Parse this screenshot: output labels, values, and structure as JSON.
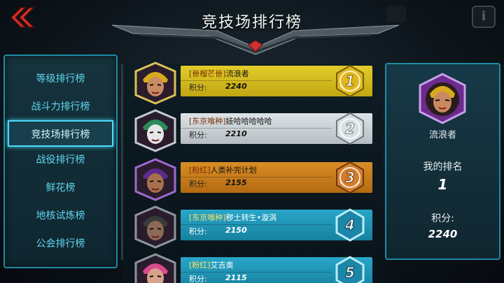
{
  "header": {
    "title": "竞技场排行榜"
  },
  "menu": {
    "items": [
      {
        "label": "等级排行榜"
      },
      {
        "label": "战斗力排行榜"
      },
      {
        "label": "竞技场排行榜",
        "active": true
      },
      {
        "label": "战役排行榜"
      },
      {
        "label": "鲜花榜"
      },
      {
        "label": "地核试炼榜"
      },
      {
        "label": "公会排行榜"
      }
    ]
  },
  "score_label": "积分:",
  "rows": [
    {
      "rank": "1",
      "guild": "[卌榴芒卌]",
      "name": "流浪者",
      "score": "2240",
      "medal": "gold"
    },
    {
      "rank": "2",
      "guild": "[东京喰种]",
      "name": "娃哈哈哈哈哈",
      "score": "2210",
      "medal": "silver"
    },
    {
      "rank": "3",
      "guild": "[粉红]",
      "name": "人类补完计划",
      "score": "2155",
      "medal": "bronze"
    },
    {
      "rank": "4",
      "guild": "[东京喰种]",
      "name": "秽土转生•漩涡",
      "score": "2150",
      "medal": "blue"
    },
    {
      "rank": "5",
      "guild": "[粉红]",
      "name": "艾吉奥",
      "score": "2115",
      "medal": "blue"
    }
  ],
  "me": {
    "name": "流浪者",
    "rank_label": "我的排名",
    "rank": "1",
    "score_label": "积分:",
    "score": "2240"
  },
  "colors": {
    "gold": "#c9b21a",
    "silver": "#c7ced2",
    "bronze": "#c27a1c",
    "blue": "#1e93b6",
    "panel_border": "#1f8aa3"
  }
}
